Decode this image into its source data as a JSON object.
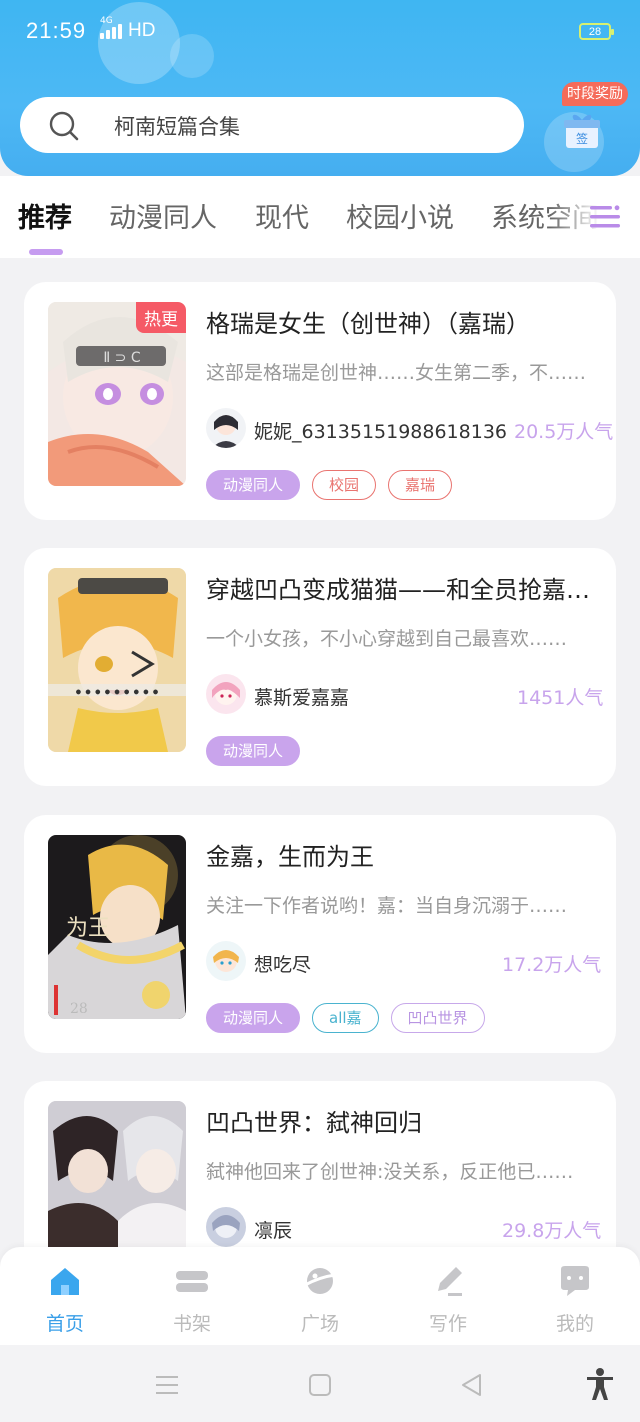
{
  "status_bar": {
    "time": "21:59",
    "network": "4G",
    "hd": "HD",
    "battery": "28"
  },
  "search": {
    "value": "柯南短篇合集",
    "icon": "search-icon"
  },
  "reward": {
    "badge": "时段奖励",
    "sign_label": "签"
  },
  "tabs": [
    {
      "label": "推荐",
      "active": true
    },
    {
      "label": "动漫同人"
    },
    {
      "label": "现代"
    },
    {
      "label": "校园小说"
    },
    {
      "label": "系统空间"
    }
  ],
  "books": [
    {
      "title": "格瑞是女生（创世神）（嘉瑞）",
      "description": "这部是格瑞是创世神……女生第二季，不……",
      "author": "妮妮_63135151988618136",
      "popularity": "20.5万人气",
      "hot_badge": "热更",
      "tags": [
        {
          "label": "动漫同人",
          "style": "purple-fill"
        },
        {
          "label": "校园",
          "style": "red"
        },
        {
          "label": "嘉瑞",
          "style": "red"
        }
      ]
    },
    {
      "title": "穿越凹凸变成猫猫——和全员抢嘉……",
      "description": "一个小女孩，不小心穿越到自己最喜欢……",
      "author": "慕斯爱嘉嘉",
      "popularity": "1451人气",
      "tags": [
        {
          "label": "动漫同人",
          "style": "purple-fill"
        }
      ]
    },
    {
      "title": "金嘉，生而为王",
      "description": "关注一下作者说哟！嘉：当自身沉溺于……",
      "author": "想吃尽",
      "popularity": "17.2万人气",
      "tags": [
        {
          "label": "动漫同人",
          "style": "purple-fill"
        },
        {
          "label": "all嘉",
          "style": "cyan"
        },
        {
          "label": "凹凸世界",
          "style": "lav"
        }
      ]
    },
    {
      "title": "凹凸世界：弑神回归",
      "description": "弑神他回来了创世神:没关系，反正他已……",
      "author": "凛辰",
      "popularity": "29.8万人气",
      "tags": []
    }
  ],
  "bottom_nav": [
    {
      "label": "首页",
      "icon": "home-icon",
      "active": true
    },
    {
      "label": "书架",
      "icon": "bookshelf-icon"
    },
    {
      "label": "广场",
      "icon": "planet-icon"
    },
    {
      "label": "写作",
      "icon": "pencil-icon"
    },
    {
      "label": "我的",
      "icon": "chat-bubble-icon"
    }
  ],
  "colors": {
    "header": "#45aef0",
    "accent_purple": "#c9a4ec",
    "hot_red": "#f55a66",
    "nav_active": "#3a9fe8"
  }
}
